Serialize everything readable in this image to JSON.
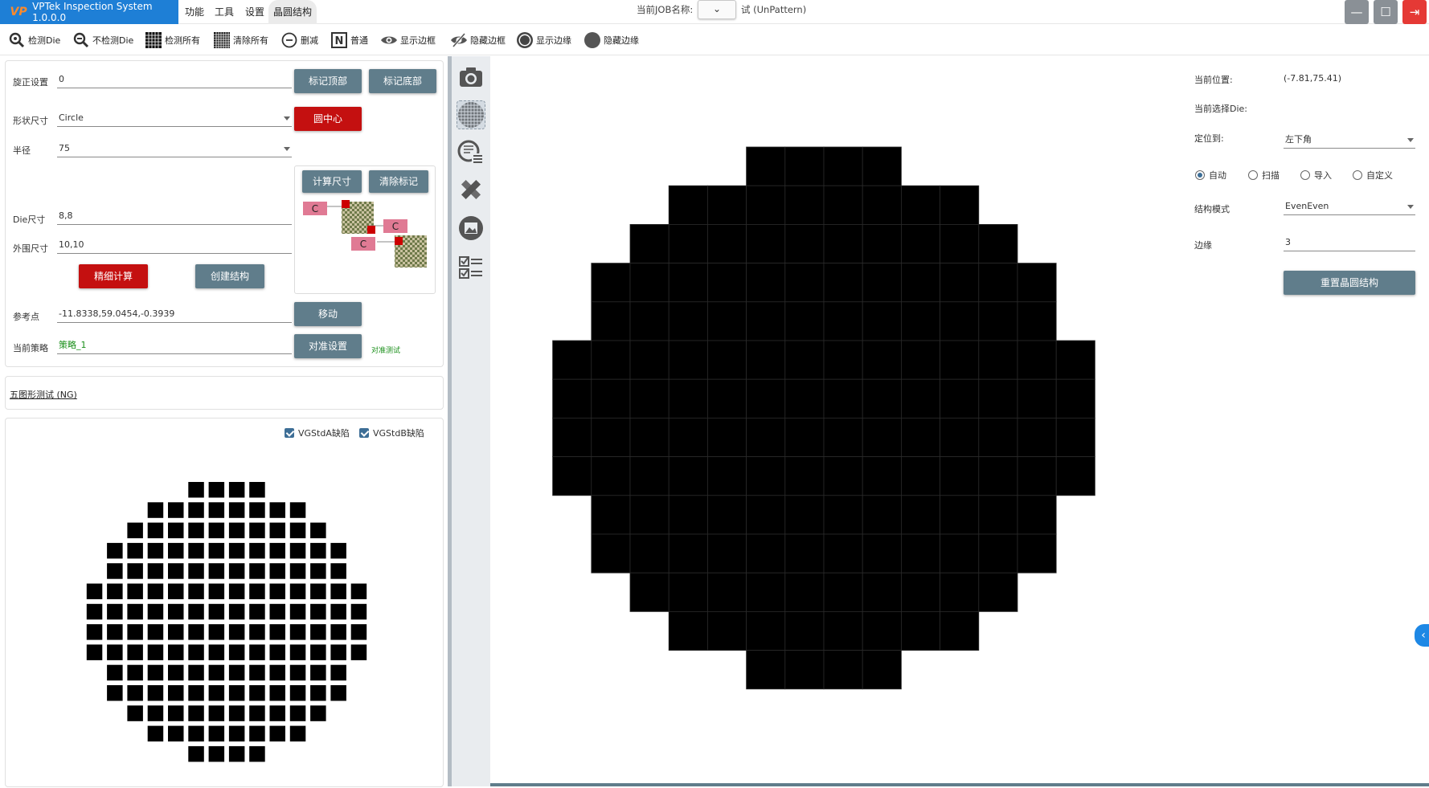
{
  "app": {
    "logo": "VP",
    "title": "VPTek Inspection System 1.0.0.0"
  },
  "menu": [
    "功能",
    "工具",
    "设置",
    "晶圆结构"
  ],
  "job": {
    "label": "当前JOB名称:",
    "name": "试 (UnPattern)"
  },
  "window_controls": {
    "minimize": "—",
    "maximize": "☐",
    "close": "⇥"
  },
  "toolbar": [
    {
      "label": "检测Die",
      "icon": "magnifier-icon"
    },
    {
      "label": "不检测Die",
      "icon": "magnifier-dash-icon"
    },
    {
      "label": "检测所有",
      "icon": "grid-all-icon"
    },
    {
      "label": "清除所有",
      "icon": "grid-clear-icon"
    },
    {
      "label": "删减",
      "icon": "minus-circle-icon"
    },
    {
      "label": "普通",
      "icon": "n-box-icon"
    },
    {
      "label": "显示边框",
      "icon": "eye-icon"
    },
    {
      "label": "隐藏边框",
      "icon": "eye-off-icon"
    },
    {
      "label": "显示边缘",
      "icon": "ring-icon"
    },
    {
      "label": "隐藏边缘",
      "icon": "disc-icon"
    }
  ],
  "settings": {
    "rotation_label": "旋正设置",
    "rotation_value": "0",
    "mark_top": "标记顶部",
    "mark_bottom": "标记底部",
    "shape_label": "形状尺寸",
    "shape_value": "Circle",
    "circle_center": "圆中心",
    "radius_label": "半径",
    "radius_value": "75",
    "calc_size": "计算尺寸",
    "clear_marks": "清除标记",
    "marker_letter": "C",
    "die_label": "Die尺寸",
    "die_value": "8,8",
    "outer_label": "外围尺寸",
    "outer_value": "10,10",
    "fine_calc": "精细计算",
    "create_struct": "创建结构",
    "ref_label": "参考点",
    "ref_value": "-11.8338,59.0454,-0.3939",
    "move": "移动",
    "strategy_label": "当前策略",
    "strategy_value": "策略_1",
    "align_settings": "对准设置",
    "align_test": "对准测试"
  },
  "status_link": "五图形测试 (NG)",
  "map_checks": [
    {
      "label": "VGStdA缺陷",
      "checked": true
    },
    {
      "label": "VGStdB缺陷",
      "checked": true
    }
  ],
  "side_tools": [
    "camera-icon",
    "wafer-grid-icon",
    "wafer-list-icon",
    "ruler-tools-icon",
    "image-frame-icon",
    "checklist-icon"
  ],
  "right": {
    "pos_label": "当前位置:",
    "pos_value": "(-7.81,75.41)",
    "die_sel_label": "当前选择Die:",
    "locate_label": "定位到:",
    "locate_value": "左下角",
    "modes": [
      {
        "label": "自动",
        "checked": true
      },
      {
        "label": "扫描",
        "checked": false
      },
      {
        "label": "导入",
        "checked": false
      },
      {
        "label": "自定义",
        "checked": false
      }
    ],
    "struct_label": "结构模式",
    "struct_value": "EvenEven",
    "edge_label": "边缘",
    "edge_value": "3",
    "reset_button": "重置晶圆结构"
  },
  "collapse": "‹",
  "wafer_rows": [
    4,
    8,
    10,
    12,
    12,
    14,
    14,
    14,
    14,
    12,
    12,
    10,
    8,
    4
  ]
}
